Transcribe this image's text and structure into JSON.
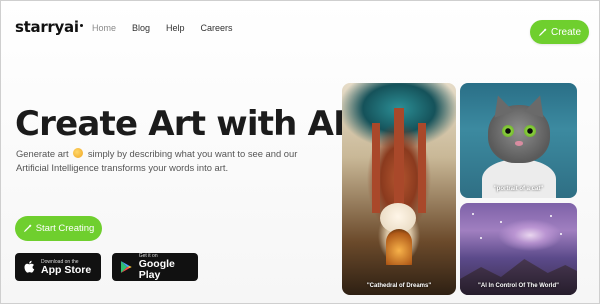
{
  "header": {
    "logo": "starryai",
    "nav": [
      "Home",
      "Blog",
      "Help",
      "Careers"
    ],
    "create_label": "Create"
  },
  "hero": {
    "headline": "Create Art with AI",
    "subtitle_part1": "Generate art",
    "subtitle_part2": "simply by describing what you want to see and our Artificial Intelligence transforms your words into art.",
    "start_label": "Start Creating",
    "appstore_small": "Download on the",
    "appstore_big": "App Store",
    "gplay_small": "Get it on",
    "gplay_big": "Google Play"
  },
  "gallery": {
    "cathedral_caption": "\"Cathedral of Dreams\"",
    "cat_caption": "\"portrait of a cat\"",
    "space_caption": "\"AI In Control Of The World\""
  },
  "colors": {
    "accent": "#6fcf2e",
    "dark": "#111111"
  },
  "icons": [
    "brush-icon",
    "apple-icon",
    "play-store-icon",
    "emoji-icon"
  ]
}
